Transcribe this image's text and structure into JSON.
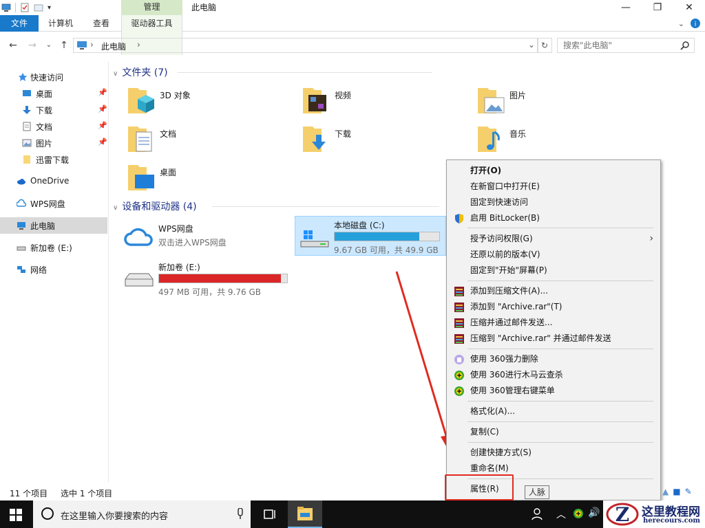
{
  "window": {
    "title": "此电脑",
    "manage_tab": "管理",
    "tabs": {
      "file": "文件",
      "computer": "计算机",
      "view": "查看",
      "drive_tools": "驱动器工具"
    }
  },
  "address": {
    "breadcrumb": "此电脑",
    "search_placeholder": "搜索\"此电脑\""
  },
  "nav": {
    "quick_access": "快速访问",
    "items": [
      "桌面",
      "下载",
      "文档",
      "图片",
      "迅雷下载"
    ],
    "onedrive": "OneDrive",
    "wps": "WPS网盘",
    "this_pc": "此电脑",
    "new_volume": "新加卷 (E:)",
    "network": "网络"
  },
  "folders": {
    "header": "文件夹 (7)",
    "items": [
      "3D 对象",
      "视频",
      "图片",
      "文档",
      "下载",
      "音乐",
      "桌面"
    ]
  },
  "devices": {
    "header": "设备和驱动器 (4)",
    "wps_name": "WPS网盘",
    "wps_desc": "双击进入WPS网盘",
    "c_name": "本地磁盘 (C:)",
    "c_info": "9.67 GB 可用，共 49.9 GB",
    "c_used_fraction": 0.81,
    "e_name": "新加卷 (E:)",
    "e_info": "497 MB 可用，共 9.76 GB",
    "e_used_fraction": 0.95
  },
  "status": {
    "count": "11 个项目",
    "selected": "选中 1 个项目"
  },
  "context_menu": {
    "open": "打开(O)",
    "open_new_window": "在新窗口中打开(E)",
    "pin_quick": "固定到快速访问",
    "bitlocker": "启用 BitLocker(B)",
    "grant_access": "授予访问权限(G)",
    "restore": "还原以前的版本(V)",
    "pin_start": "固定到\"开始\"屏幕(P)",
    "add_archive": "添加到压缩文件(A)...",
    "add_rar": "添加到 \"Archive.rar\"(T)",
    "compress_email": "压缩并通过邮件发送...",
    "compress_rar_email": "压缩到 \"Archive.rar\" 并通过邮件发送",
    "del_360": "使用 360强力删除",
    "scan_360": "使用 360进行木马云查杀",
    "manage_360": "使用 360管理右键菜单",
    "format": "格式化(A)...",
    "copy": "复制(C)",
    "shortcut": "创建快捷方式(S)",
    "rename": "重命名(M)",
    "properties": "属性(R)"
  },
  "tooltip": "人脉",
  "taskbar": {
    "search_text": "在这里输入你要搜索的内容"
  },
  "watermark": {
    "title": "这里教程网",
    "url": "herecours.com"
  },
  "colors": {
    "accent": "#1979ca",
    "c_bar": "#26a0da",
    "e_bar": "#da2626",
    "highlight": "#e02b20"
  }
}
